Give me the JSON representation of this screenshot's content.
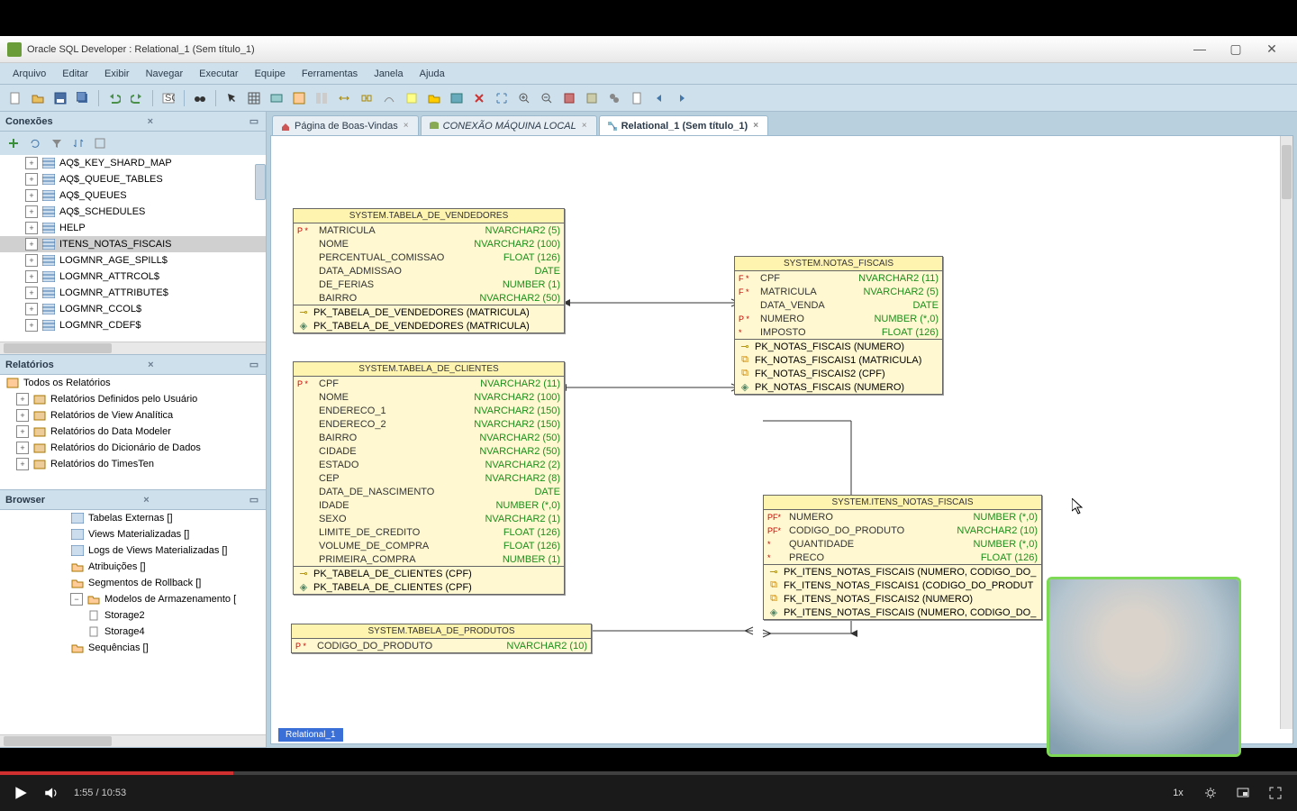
{
  "window": {
    "title": "Oracle SQL Developer : Relational_1 (Sem título_1)"
  },
  "menu": [
    "Arquivo",
    "Editar",
    "Exibir",
    "Navegar",
    "Executar",
    "Equipe",
    "Ferramentas",
    "Janela",
    "Ajuda"
  ],
  "panels": {
    "connections": {
      "title": "Conexões",
      "items": [
        "AQ$_KEY_SHARD_MAP",
        "AQ$_QUEUE_TABLES",
        "AQ$_QUEUES",
        "AQ$_SCHEDULES",
        "HELP",
        "ITENS_NOTAS_FISCAIS",
        "LOGMNR_AGE_SPILL$",
        "LOGMNR_ATTRCOL$",
        "LOGMNR_ATTRIBUTE$",
        "LOGMNR_CCOL$",
        "LOGMNR_CDEF$"
      ],
      "selected": 5
    },
    "reports": {
      "title": "Relatórios",
      "root": "Todos os Relatórios",
      "items": [
        "Relatórios Definidos pelo Usuário",
        "Relatórios de View Analítica",
        "Relatórios do Data Modeler",
        "Relatórios do Dicionário de Dados",
        "Relatórios do TimesTen"
      ]
    },
    "browser": {
      "title": "Browser",
      "items": [
        {
          "label": "Tabelas Externas []",
          "indent": 1,
          "icon": "table"
        },
        {
          "label": "Views Materializadas []",
          "indent": 1,
          "icon": "table"
        },
        {
          "label": "Logs de Views Materializadas []",
          "indent": 1,
          "icon": "table"
        },
        {
          "label": "Atribuições []",
          "indent": 1,
          "icon": "folder"
        },
        {
          "label": "Segmentos de Rollback []",
          "indent": 1,
          "icon": "folder"
        },
        {
          "label": "Modelos de Armazenamento [",
          "indent": 1,
          "icon": "folder",
          "expanded": true
        },
        {
          "label": "Storage2",
          "indent": 2,
          "icon": "leaf"
        },
        {
          "label": "Storage4",
          "indent": 2,
          "icon": "leaf"
        },
        {
          "label": "Sequências []",
          "indent": 1,
          "icon": "folder"
        }
      ]
    }
  },
  "tabs": [
    {
      "label": "Página de Boas-Vindas",
      "icon": "home"
    },
    {
      "label": "CONEXÃO MÁQUINA LOCAL",
      "icon": "db",
      "italic": true
    },
    {
      "label": "Relational_1 (Sem título_1)",
      "icon": "diagram",
      "active": true
    }
  ],
  "bottom_tab": "Relational_1",
  "er": {
    "vendedores": {
      "title": "SYSTEM.TABELA_DE_VENDEDORES",
      "cols": [
        {
          "f": "P *",
          "n": "MATRICULA",
          "t": "NVARCHAR2 (5)"
        },
        {
          "f": "",
          "n": "NOME",
          "t": "NVARCHAR2 (100)"
        },
        {
          "f": "",
          "n": "PERCENTUAL_COMISSAO",
          "t": "FLOAT (126)"
        },
        {
          "f": "",
          "n": "DATA_ADMISSAO",
          "t": "DATE"
        },
        {
          "f": "",
          "n": "DE_FERIAS",
          "t": "NUMBER (1)"
        },
        {
          "f": "",
          "n": "BAIRRO",
          "t": "NVARCHAR2 (50)"
        }
      ],
      "keys": [
        {
          "i": "pk",
          "t": "PK_TABELA_DE_VENDEDORES (MATRICULA)"
        },
        {
          "i": "pk2",
          "t": "PK_TABELA_DE_VENDEDORES (MATRICULA)"
        }
      ]
    },
    "clientes": {
      "title": "SYSTEM.TABELA_DE_CLIENTES",
      "cols": [
        {
          "f": "P *",
          "n": "CPF",
          "t": "NVARCHAR2 (11)"
        },
        {
          "f": "",
          "n": "NOME",
          "t": "NVARCHAR2 (100)"
        },
        {
          "f": "",
          "n": "ENDERECO_1",
          "t": "NVARCHAR2 (150)"
        },
        {
          "f": "",
          "n": "ENDERECO_2",
          "t": "NVARCHAR2 (150)"
        },
        {
          "f": "",
          "n": "BAIRRO",
          "t": "NVARCHAR2 (50)"
        },
        {
          "f": "",
          "n": "CIDADE",
          "t": "NVARCHAR2 (50)"
        },
        {
          "f": "",
          "n": "ESTADO",
          "t": "NVARCHAR2 (2)"
        },
        {
          "f": "",
          "n": "CEP",
          "t": "NVARCHAR2 (8)"
        },
        {
          "f": "",
          "n": "DATA_DE_NASCIMENTO",
          "t": "DATE"
        },
        {
          "f": "",
          "n": "IDADE",
          "t": "NUMBER (*,0)"
        },
        {
          "f": "",
          "n": "SEXO",
          "t": "NVARCHAR2 (1)"
        },
        {
          "f": "",
          "n": "LIMITE_DE_CREDITO",
          "t": "FLOAT (126)"
        },
        {
          "f": "",
          "n": "VOLUME_DE_COMPRA",
          "t": "FLOAT (126)"
        },
        {
          "f": "",
          "n": "PRIMEIRA_COMPRA",
          "t": "NUMBER (1)"
        }
      ],
      "keys": [
        {
          "i": "pk",
          "t": "PK_TABELA_DE_CLIENTES (CPF)"
        },
        {
          "i": "pk2",
          "t": "PK_TABELA_DE_CLIENTES (CPF)"
        }
      ]
    },
    "notas": {
      "title": "SYSTEM.NOTAS_FISCAIS",
      "cols": [
        {
          "f": "F *",
          "n": "CPF",
          "t": "NVARCHAR2 (11)"
        },
        {
          "f": "F *",
          "n": "MATRICULA",
          "t": "NVARCHAR2 (5)"
        },
        {
          "f": "",
          "n": "DATA_VENDA",
          "t": "DATE"
        },
        {
          "f": "P *",
          "n": "NUMERO",
          "t": "NUMBER (*,0)"
        },
        {
          "f": "*",
          "n": "IMPOSTO",
          "t": "FLOAT (126)"
        }
      ],
      "keys": [
        {
          "i": "pk",
          "t": "PK_NOTAS_FISCAIS (NUMERO)"
        },
        {
          "i": "fk",
          "t": "FK_NOTAS_FISCAIS1 (MATRICULA)"
        },
        {
          "i": "fk",
          "t": "FK_NOTAS_FISCAIS2 (CPF)"
        },
        {
          "i": "pk2",
          "t": "PK_NOTAS_FISCAIS (NUMERO)"
        }
      ]
    },
    "itens": {
      "title": "SYSTEM.ITENS_NOTAS_FISCAIS",
      "cols": [
        {
          "f": "PF*",
          "n": "NUMERO",
          "t": "NUMBER (*,0)"
        },
        {
          "f": "PF*",
          "n": "CODIGO_DO_PRODUTO",
          "t": "NVARCHAR2 (10)"
        },
        {
          "f": "*",
          "n": "QUANTIDADE",
          "t": "NUMBER (*,0)"
        },
        {
          "f": "*",
          "n": "PRECO",
          "t": "FLOAT (126)"
        }
      ],
      "keys": [
        {
          "i": "pk",
          "t": "PK_ITENS_NOTAS_FISCAIS (NUMERO, CODIGO_DO_"
        },
        {
          "i": "fk",
          "t": "FK_ITENS_NOTAS_FISCAIS1 (CODIGO_DO_PRODUT"
        },
        {
          "i": "fk",
          "t": "FK_ITENS_NOTAS_FISCAIS2 (NUMERO)"
        },
        {
          "i": "pk2",
          "t": "PK_ITENS_NOTAS_FISCAIS (NUMERO, CODIGO_DO_"
        }
      ]
    },
    "produtos": {
      "title": "SYSTEM.TABELA_DE_PRODUTOS",
      "cols": [
        {
          "f": "P *",
          "n": "CODIGO_DO_PRODUTO",
          "t": "NVARCHAR2 (10)"
        }
      ]
    }
  },
  "video": {
    "current": "1:55",
    "total": "10:53",
    "speed": "1x"
  }
}
